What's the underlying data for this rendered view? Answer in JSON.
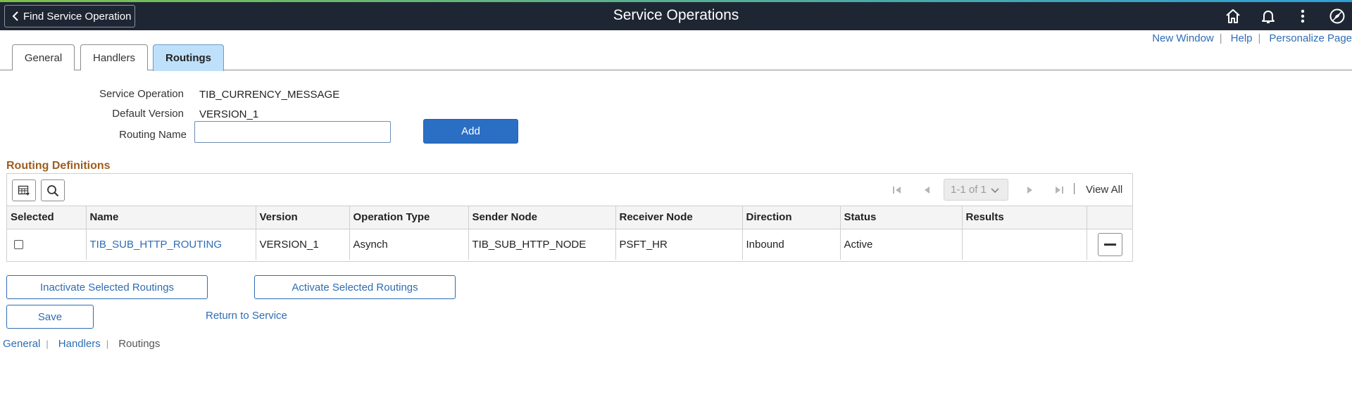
{
  "header": {
    "title": "Service Operations",
    "back_label": "Find Service Operation"
  },
  "top_links": [
    "New Window",
    "Help",
    "Personalize Page"
  ],
  "tabs": [
    "General",
    "Handlers",
    "Routings"
  ],
  "active_tab": "Routings",
  "form": {
    "service_operation_label": "Service Operation",
    "service_operation_value": "TIB_CURRENCY_MESSAGE",
    "default_version_label": "Default Version",
    "default_version_value": "VERSION_1",
    "routing_name_label": "Routing Name",
    "routing_name_value": "",
    "add_label": "Add"
  },
  "grid": {
    "title": "Routing Definitions",
    "pager_text": "1-1 of 1",
    "view_all": "View All",
    "columns": [
      "Selected",
      "Name",
      "Version",
      "Operation Type",
      "Sender Node",
      "Receiver Node",
      "Direction",
      "Status",
      "Results",
      ""
    ],
    "rows": [
      {
        "name": "TIB_SUB_HTTP_ROUTING",
        "version": "VERSION_1",
        "operation_type": "Asynch",
        "sender_node": "TIB_SUB_HTTP_NODE",
        "receiver_node": "PSFT_HR",
        "direction": "Inbound",
        "status": "Active",
        "results": ""
      }
    ]
  },
  "actions": {
    "inactivate": "Inactivate Selected Routings",
    "activate": "Activate Selected Routings",
    "save": "Save",
    "return": "Return to Service"
  },
  "bottom_nav": [
    "General",
    "Handlers",
    "Routings"
  ],
  "colors": {
    "header_bg": "#1f2633",
    "accent": "#2b6fc4",
    "link": "#2e6db4",
    "active_tab": "#bee0fb",
    "section_title": "#9c5d1e"
  }
}
